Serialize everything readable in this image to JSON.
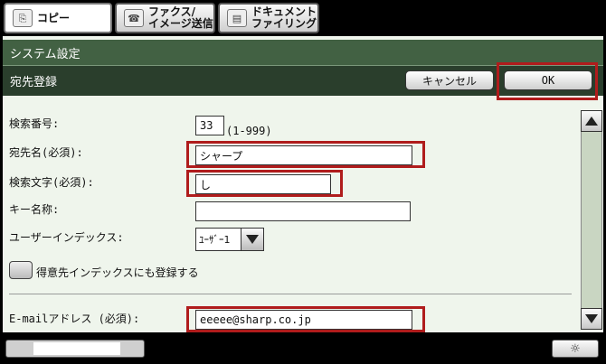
{
  "tabs": [
    {
      "label": "コピー",
      "icon": "copy-icon"
    },
    {
      "label": "ファクス/\nイメージ送信",
      "icon": "fax-icon"
    },
    {
      "label": "ドキュメント\nファイリング",
      "icon": "document-filing-icon"
    }
  ],
  "header": {
    "system_title": "システム設定",
    "section_title": "宛先登録",
    "cancel_label": "キャンセル",
    "ok_label": "OK"
  },
  "form": {
    "search_number_label": "検索番号:",
    "search_number_value": "33",
    "search_number_range": "(1-999)",
    "destination_name_label": "宛先名(必須):",
    "destination_name_value": "シャープ",
    "search_chars_label": "検索文字(必須):",
    "search_chars_value": "し",
    "key_name_label": "キー名称:",
    "key_name_value": "",
    "user_index_label": "ユーザーインデックス:",
    "user_index_value": "ﾕｰｻﾞｰ1",
    "favorites_label": "得意先インデックスにも登録する",
    "email_label": "E-mailアドレス (必須):",
    "email_value": "eeeee@sharp.co.jp"
  },
  "colors": {
    "highlight": "#b01c1c",
    "header_dark": "#2a3e2c",
    "header_mid": "#426143",
    "panel_bg": "#eff5ec"
  }
}
